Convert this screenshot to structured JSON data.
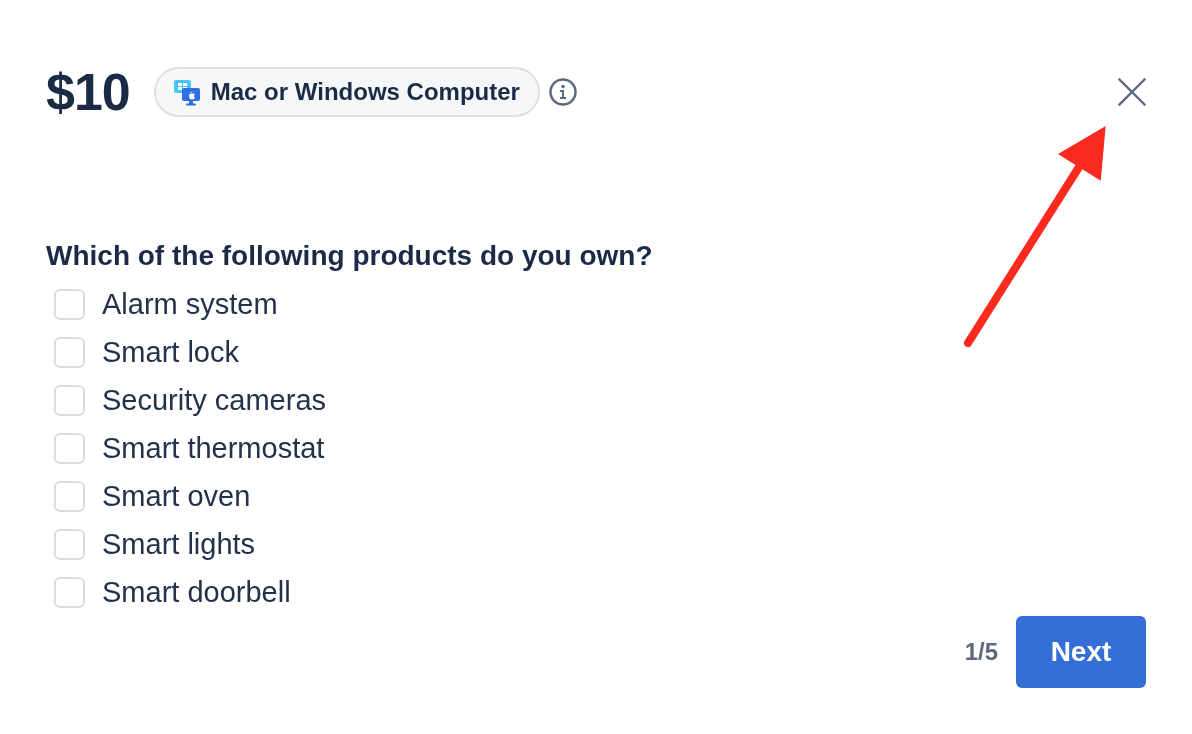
{
  "price": "$10",
  "device_tag": {
    "label": "Mac or Windows Computer"
  },
  "question": {
    "text": "Which of the following products do you own?",
    "options": [
      {
        "label": "Alarm system",
        "checked": false
      },
      {
        "label": "Smart lock",
        "checked": false
      },
      {
        "label": "Security cameras",
        "checked": false
      },
      {
        "label": "Smart thermostat",
        "checked": false
      },
      {
        "label": "Smart oven",
        "checked": false
      },
      {
        "label": "Smart lights",
        "checked": false
      },
      {
        "label": "Smart doorbell",
        "checked": false
      }
    ]
  },
  "footer": {
    "progress": "1/5",
    "next_button": "Next"
  }
}
